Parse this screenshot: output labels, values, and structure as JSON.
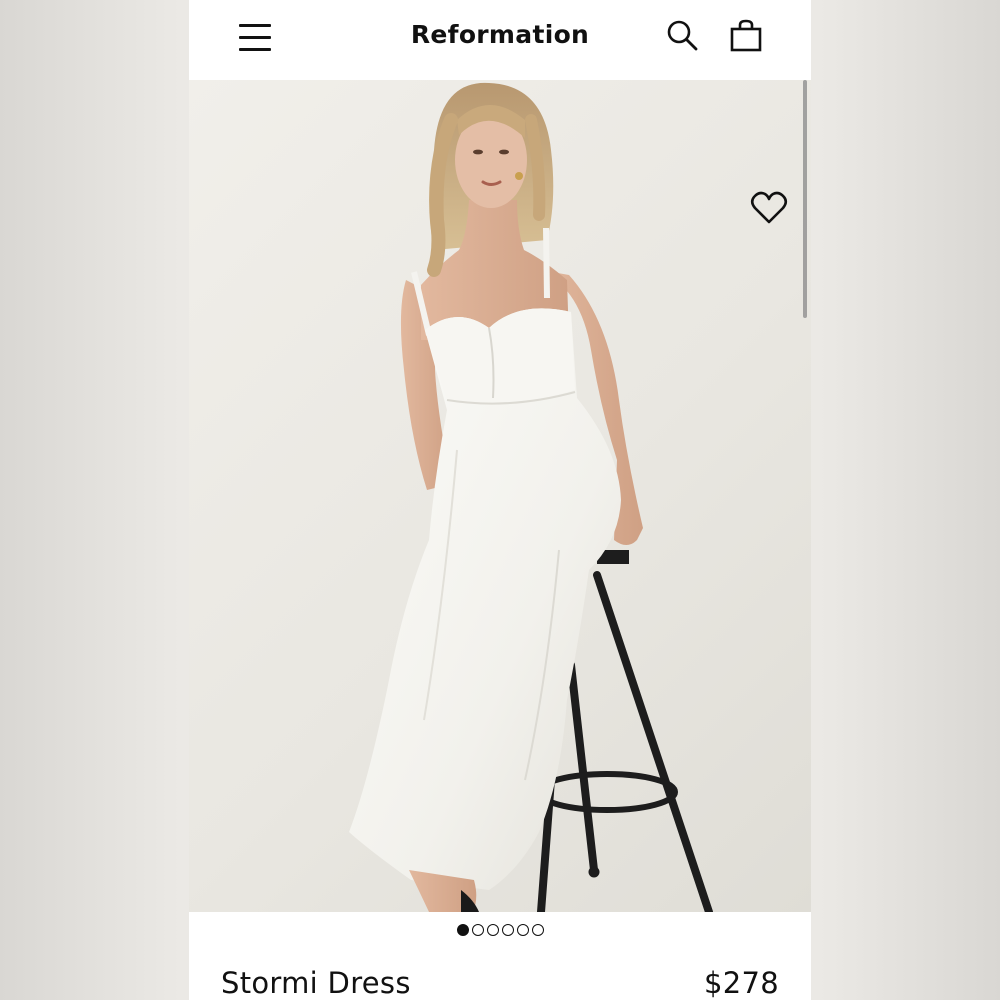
{
  "header": {
    "brand": "Reformation",
    "menu_icon": "hamburger-menu-icon",
    "search_icon": "search-icon",
    "bag_icon": "shopping-bag-icon"
  },
  "gallery": {
    "favorite_icon": "heart-outline-icon",
    "image_subject": "model in white sweetheart-neckline midi dress seated on black bar stool",
    "image_count": 6,
    "active_index": 0
  },
  "product": {
    "name": "Stormi Dress",
    "price": "$278"
  },
  "colors": {
    "text": "#111111",
    "background": "#ffffff",
    "photo_backdrop": "#ebe9e4"
  }
}
